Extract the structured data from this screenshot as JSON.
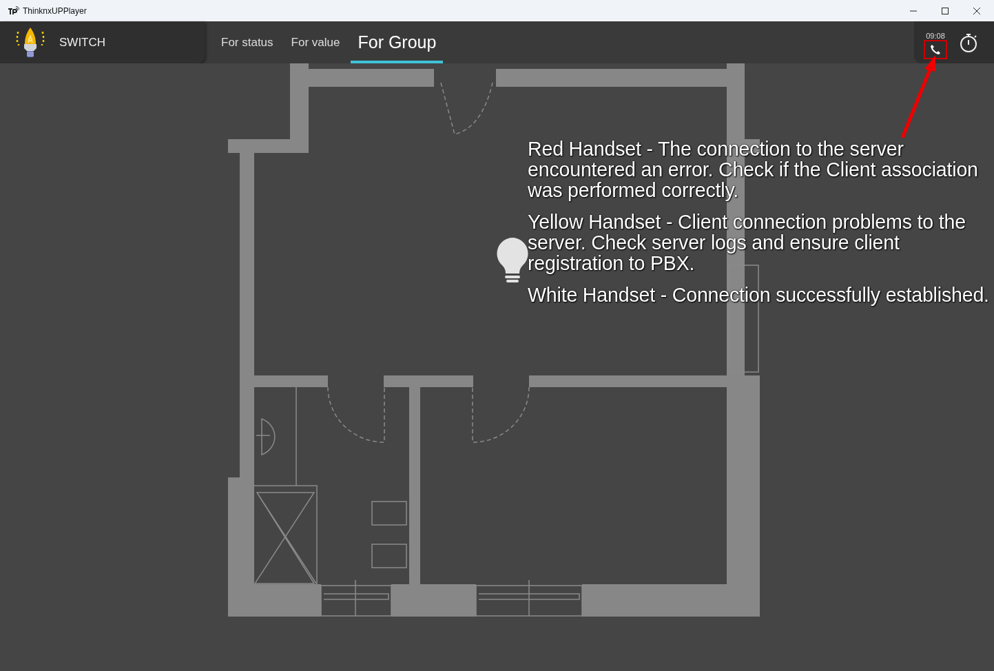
{
  "window": {
    "title": "ThinknxUPPlayer"
  },
  "header": {
    "page_name": "SWITCH",
    "clock": "09:08"
  },
  "tabs": [
    {
      "label": "For status",
      "selected": false
    },
    {
      "label": "For value",
      "selected": false
    },
    {
      "label": "For Group",
      "selected": true
    }
  ],
  "annotation": {
    "paragraphs": [
      "Red Handset - The connection to the server encountered an error. Check if the Client association was performed correctly.",
      "Yellow Handset - Client connection problems to the server. Check server logs and ensure client registration to PBX.",
      "White Handset - Connection successfully established."
    ]
  }
}
